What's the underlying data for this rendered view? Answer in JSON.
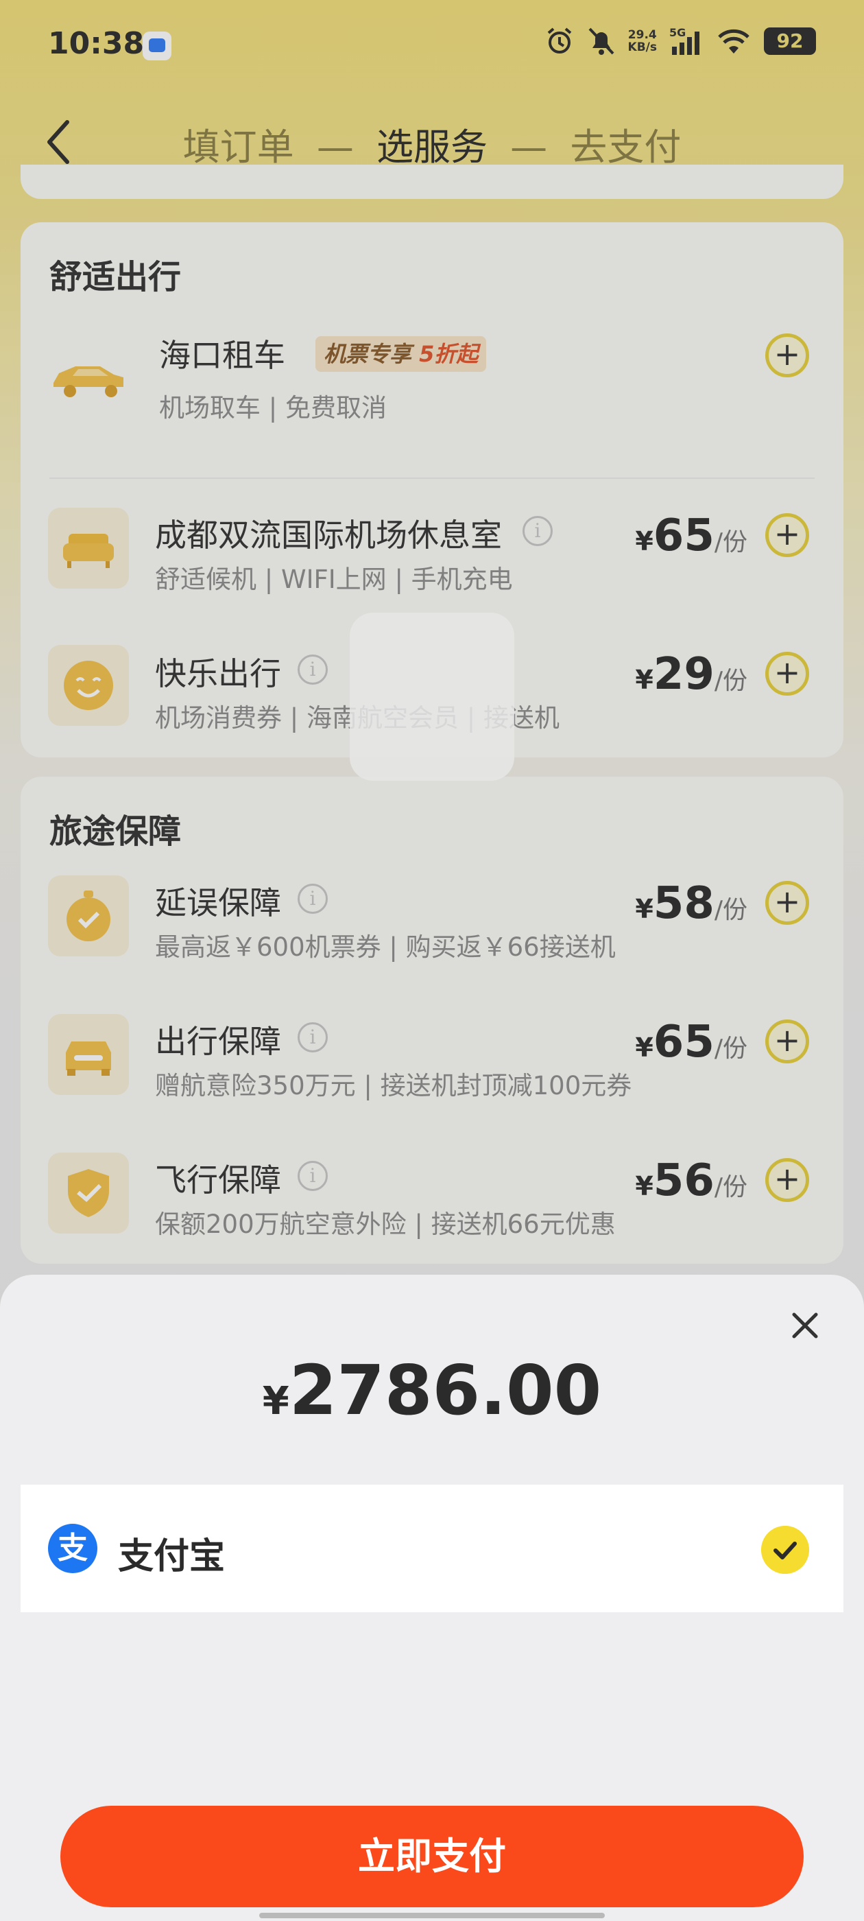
{
  "status_bar": {
    "time": "10:38",
    "net_speed_value": "29.4",
    "net_speed_unit": "KB/s",
    "network": "5G",
    "battery": "92"
  },
  "nav": {
    "step1": "填订单",
    "step2": "选服务",
    "step3": "去支付",
    "separator": "—"
  },
  "comfort": {
    "title": "舒适出行",
    "car_rental": {
      "name": "海口租车",
      "tag_text": "机票专享",
      "tag_discount": "5折起",
      "desc": "机场取车 | 免费取消"
    },
    "lounge": {
      "name": "成都双流国际机场休息室",
      "desc": "舒适候机 | WIFI上网 | 手机充电",
      "currency": "¥",
      "price": "65",
      "unit": "/份"
    },
    "happy": {
      "name": "快乐出行",
      "desc": "机场消费券 | 海南航空会员 | 接送机",
      "currency": "¥",
      "price": "29",
      "unit": "/份"
    }
  },
  "insurance": {
    "title": "旅途保障",
    "delay": {
      "name": "延误保障",
      "desc": "最高返￥600机票券 | 购买返￥66接送机",
      "currency": "¥",
      "price": "58",
      "unit": "/份"
    },
    "travel": {
      "name": "出行保障",
      "desc": "赠航意险350万元 | 接送机封顶减100元券",
      "currency": "¥",
      "price": "65",
      "unit": "/份"
    },
    "flight": {
      "name": "飞行保障",
      "desc": "保额200万航空意外险 | 接送机66元优惠",
      "currency": "¥",
      "price": "56",
      "unit": "/份"
    }
  },
  "payment_sheet": {
    "currency": "¥",
    "amount": "2786.00",
    "method_logo": "支",
    "method_name": "支付宝",
    "pay_button": "立即支付"
  }
}
